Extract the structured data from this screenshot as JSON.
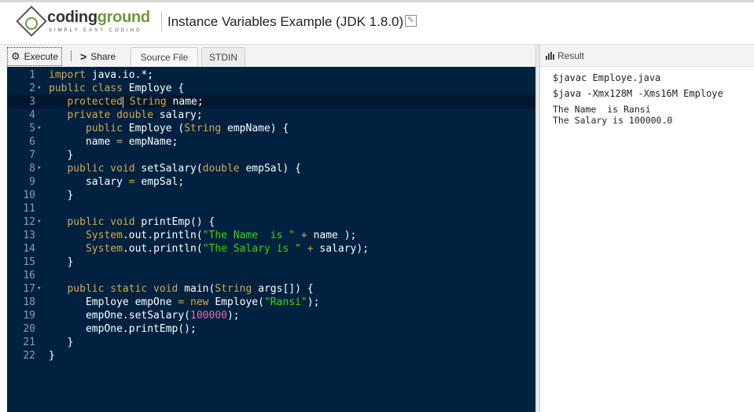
{
  "header": {
    "logo_name_a": "coding",
    "logo_name_b": "ground",
    "logo_tagline": "SIMPLY EASY CODING",
    "title": "Instance Variables Example (JDK 1.8.0)"
  },
  "toolbar": {
    "execute": "Execute",
    "share": "Share",
    "tabs": [
      "Source File",
      "STDIN"
    ]
  },
  "editor": {
    "lines": [
      {
        "n": "1",
        "fold": false,
        "t": [
          [
            "kw",
            "import"
          ],
          [
            "id",
            " java.io.*;"
          ]
        ]
      },
      {
        "n": "2",
        "fold": true,
        "t": [
          [
            "kw",
            "public class"
          ],
          [
            "id",
            " Employe {"
          ]
        ]
      },
      {
        "n": "3",
        "fold": false,
        "cur": true,
        "t": [
          [
            "id",
            "   "
          ],
          [
            "kw",
            "protected"
          ],
          [
            "cursor",
            ""
          ],
          [
            "kw",
            " String"
          ],
          [
            "id",
            " name;"
          ]
        ]
      },
      {
        "n": "4",
        "fold": false,
        "t": [
          [
            "id",
            "   "
          ],
          [
            "kw",
            "private double"
          ],
          [
            "id",
            " salary;"
          ]
        ]
      },
      {
        "n": "5",
        "fold": true,
        "t": [
          [
            "id",
            "      "
          ],
          [
            "kw",
            "public"
          ],
          [
            "id",
            " Employe ("
          ],
          [
            "kw",
            "String"
          ],
          [
            "id",
            " empName) {"
          ]
        ]
      },
      {
        "n": "6",
        "fold": false,
        "t": [
          [
            "id",
            "      name "
          ],
          [
            "op",
            "="
          ],
          [
            "id",
            " empName;"
          ]
        ]
      },
      {
        "n": "7",
        "fold": false,
        "t": [
          [
            "id",
            "   }"
          ]
        ]
      },
      {
        "n": "8",
        "fold": true,
        "t": [
          [
            "id",
            "   "
          ],
          [
            "kw",
            "public void"
          ],
          [
            "id",
            " setSalary("
          ],
          [
            "kw",
            "double"
          ],
          [
            "id",
            " empSal) {"
          ]
        ]
      },
      {
        "n": "9",
        "fold": false,
        "t": [
          [
            "id",
            "      salary "
          ],
          [
            "op",
            "="
          ],
          [
            "id",
            " empSal;"
          ]
        ]
      },
      {
        "n": "10",
        "fold": false,
        "t": [
          [
            "id",
            "   }"
          ]
        ]
      },
      {
        "n": "11",
        "fold": false,
        "t": []
      },
      {
        "n": "12",
        "fold": true,
        "t": [
          [
            "id",
            "   "
          ],
          [
            "kw",
            "public void"
          ],
          [
            "id",
            " printEmp() {"
          ]
        ]
      },
      {
        "n": "13",
        "fold": false,
        "t": [
          [
            "id",
            "      "
          ],
          [
            "kw",
            "System"
          ],
          [
            "id",
            ".out.println("
          ],
          [
            "str",
            "\"The Name  is \""
          ],
          [
            "op",
            " +"
          ],
          [
            "id",
            " name );"
          ]
        ]
      },
      {
        "n": "14",
        "fold": false,
        "t": [
          [
            "id",
            "      "
          ],
          [
            "kw",
            "System"
          ],
          [
            "id",
            ".out.println("
          ],
          [
            "str",
            "\"The Salary is \""
          ],
          [
            "op",
            " +"
          ],
          [
            "id",
            " salary);"
          ]
        ]
      },
      {
        "n": "15",
        "fold": false,
        "t": [
          [
            "id",
            "   }"
          ]
        ]
      },
      {
        "n": "16",
        "fold": false,
        "t": []
      },
      {
        "n": "17",
        "fold": true,
        "t": [
          [
            "id",
            "   "
          ],
          [
            "kw",
            "public static void"
          ],
          [
            "id",
            " main("
          ],
          [
            "kw",
            "String"
          ],
          [
            "id",
            " args[]) {"
          ]
        ]
      },
      {
        "n": "18",
        "fold": false,
        "t": [
          [
            "id",
            "      Employe empOne "
          ],
          [
            "op",
            "="
          ],
          [
            "kw",
            " new"
          ],
          [
            "id",
            " Employe("
          ],
          [
            "str",
            "\"Ransi\""
          ],
          [
            "id",
            ");"
          ]
        ]
      },
      {
        "n": "19",
        "fold": false,
        "t": [
          [
            "id",
            "      empOne.setSalary("
          ],
          [
            "num",
            "100000"
          ],
          [
            "id",
            ");"
          ]
        ]
      },
      {
        "n": "20",
        "fold": false,
        "t": [
          [
            "id",
            "      empOne.printEmp();"
          ]
        ]
      },
      {
        "n": "21",
        "fold": false,
        "t": [
          [
            "id",
            "   }"
          ]
        ]
      },
      {
        "n": "22",
        "fold": false,
        "t": [
          [
            "id",
            "}"
          ]
        ]
      }
    ]
  },
  "result": {
    "label": "Result",
    "commands": [
      "$javac Employe.java",
      "$java -Xmx128M -Xms16M Employe"
    ],
    "output": [
      "The Name  is Ransi",
      "The Salary is 100000.0"
    ]
  }
}
